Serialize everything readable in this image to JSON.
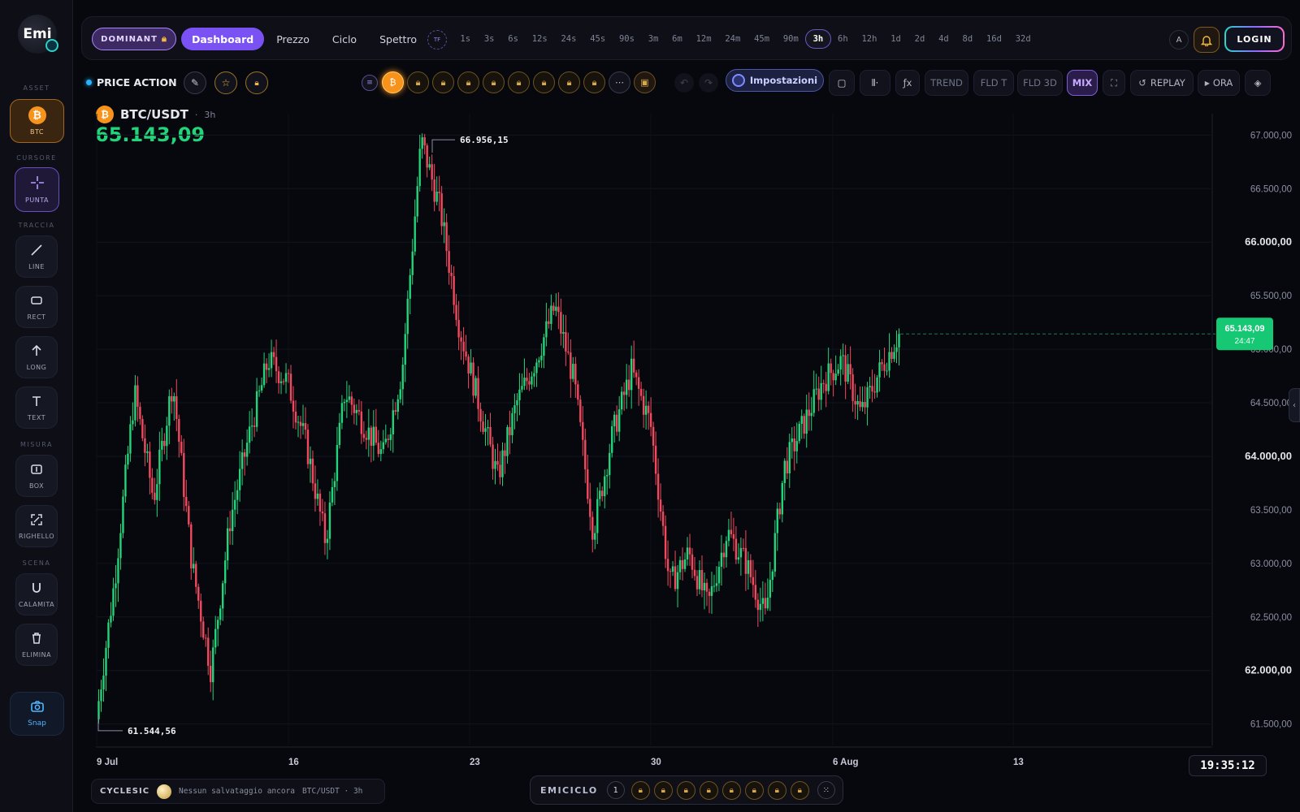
{
  "logo": {
    "text": "Emi"
  },
  "rail": {
    "sections": [
      "ASSET",
      "CURSORE",
      "TRACCIA",
      "MISURA",
      "SCENA"
    ],
    "asset": {
      "label": "BTC",
      "glyph": "₿"
    },
    "cursore": {
      "label": "PUNTA",
      "icon": "crosshair-icon"
    },
    "traccia": [
      {
        "label": "LINE",
        "icon": "line-icon"
      },
      {
        "label": "RECT",
        "icon": "rect-icon"
      },
      {
        "label": "LONG",
        "icon": "arrow-up-icon"
      },
      {
        "label": "TEXT",
        "icon": "text-icon"
      }
    ],
    "misura": [
      {
        "label": "BOX",
        "icon": "box-icon"
      },
      {
        "label": "RIGHELLO",
        "icon": "ruler-icon"
      }
    ],
    "scena": [
      {
        "label": "CALAMITA",
        "icon": "magnet-icon"
      },
      {
        "label": "ELIMINA",
        "icon": "trash-icon"
      }
    ],
    "snap": {
      "label": "Snap",
      "icon": "camera-icon"
    }
  },
  "topbar": {
    "dominant": "DOMINANT",
    "tabs": [
      "Dashboard",
      "Prezzo",
      "Ciclo",
      "Spettro"
    ],
    "active_tab": "Dashboard",
    "tf_badge": "TF",
    "timeframes": [
      "1s",
      "3s",
      "6s",
      "12s",
      "24s",
      "45s",
      "90s",
      "3m",
      "6m",
      "12m",
      "24m",
      "45m",
      "90m",
      "3h",
      "6h",
      "12h",
      "1d",
      "2d",
      "4d",
      "8d",
      "16d",
      "32d"
    ],
    "active_timeframe": "3h",
    "a_button": "A",
    "login": "LOGIN"
  },
  "toolbar2": {
    "price_action": "PRICE ACTION",
    "impostazioni": "Impostazioni",
    "trend": "TREND",
    "fld_t": "FLD T",
    "fld_3d": "FLD 3D",
    "mix": "MIX",
    "replay": "REPLAY",
    "ora": "ORA",
    "fx": "ƒx"
  },
  "symbol": {
    "pair": "BTC/USDT",
    "tf": "3h",
    "sep": "·",
    "last_price": "65.143,09"
  },
  "chart_data": {
    "type": "candlestick",
    "x_ticks": [
      "9 Jul",
      "16",
      "23",
      "30",
      "6 Aug",
      "13"
    ],
    "y_ticks": [
      "67.000,00",
      "66.500,00",
      "66.000,00",
      "65.500,00",
      "65.000,00",
      "64.500,00",
      "64.000,00",
      "63.500,00",
      "63.000,00",
      "62.500,00",
      "62.000,00",
      "61.500,00"
    ],
    "ylim": [
      61300,
      67200
    ],
    "high_label": "66.956,15",
    "low_label": "61.544,56",
    "last_value": 65143.09,
    "last_price_tag": "65.143,09",
    "countdown": "24:47",
    "key_points": [
      61544,
      62900,
      64600,
      63600,
      64700,
      63000,
      62000,
      63400,
      64200,
      64900,
      64700,
      64100,
      63200,
      64600,
      64300,
      64000,
      64800,
      66956,
      66300,
      65200,
      64500,
      63800,
      64500,
      64900,
      65400,
      64700,
      63300,
      64200,
      64800,
      64300,
      62800,
      63100,
      62600,
      63300,
      63000,
      62500,
      63900,
      64300,
      64700,
      64900,
      64400,
      64800,
      65143
    ],
    "up_color": "#22d47b",
    "down_color": "#f2495f"
  },
  "clock": "19:35:12",
  "cyclesic": {
    "label": "CYCLESIC",
    "status": "Nessun salvataggio ancora",
    "context": "BTC/USDT · 3h"
  },
  "emiciclo": {
    "label": "EMICICLO",
    "number": "1"
  }
}
